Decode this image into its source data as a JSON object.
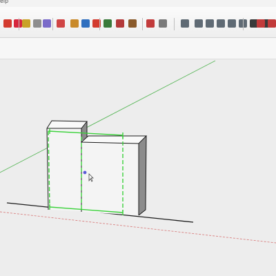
{
  "menu": {
    "help_fragment": "elp"
  },
  "toolbar": {
    "tools": [
      {
        "name": "paint-bucket-icon",
        "color": "#d33b2f"
      },
      {
        "name": "section-plane-icon",
        "color": "#d7263d"
      },
      {
        "name": "tape-measure-icon",
        "color": "#c9a227"
      },
      {
        "name": "dimension-icon",
        "color": "#8e8e8e"
      },
      {
        "name": "protractor-icon",
        "color": "#7a6bc9"
      },
      {
        "name": "orbit-icon",
        "color": "#d04545"
      },
      {
        "name": "pan-icon",
        "color": "#c98a2b"
      },
      {
        "name": "zoom-icon",
        "color": "#2f6fbf"
      },
      {
        "name": "zoom-extents-icon",
        "color": "#d33b2f"
      },
      {
        "name": "previous-view-icon",
        "color": "#3a7a3a"
      },
      {
        "name": "scene-icon",
        "color": "#b33a3a"
      },
      {
        "name": "components-icon",
        "color": "#8a5a2b"
      },
      {
        "name": "materials-icon",
        "color": "#c23b3b"
      },
      {
        "name": "user-icon",
        "color": "#7a7a7a"
      },
      {
        "name": "iso-view-icon",
        "color": "#5f6a74"
      },
      {
        "name": "top-view-icon",
        "color": "#5f6a74"
      },
      {
        "name": "front-view-icon",
        "color": "#5f6a74"
      },
      {
        "name": "right-view-icon",
        "color": "#5f6a74"
      },
      {
        "name": "back-view-icon",
        "color": "#5f6a74"
      },
      {
        "name": "left-view-icon",
        "color": "#5f6a74"
      },
      {
        "name": "xray-icon",
        "color": "#3a3a3a"
      },
      {
        "name": "wireframe-icon",
        "color": "#3a3a3a"
      },
      {
        "name": "hidden-line-icon",
        "color": "#3a3a3a"
      },
      {
        "name": "shaded-icon",
        "color": "#3a3a3a"
      },
      {
        "name": "move-icon",
        "color": "#c23b3b"
      },
      {
        "name": "rotate-icon",
        "color": "#c23b3b"
      }
    ]
  },
  "viewport": {
    "colors": {
      "sky": "#ffffff",
      "ground": "#ededed",
      "green_axis": "#5cb85c",
      "red_axis": "#d98080",
      "selection": "#3cd23c",
      "face_light": "#f4f4f4",
      "face_side": "#8c8c8c",
      "face_top": "#f9f9f9",
      "edge": "#1a1a1a",
      "inference_point": "#5a5ad8"
    }
  }
}
